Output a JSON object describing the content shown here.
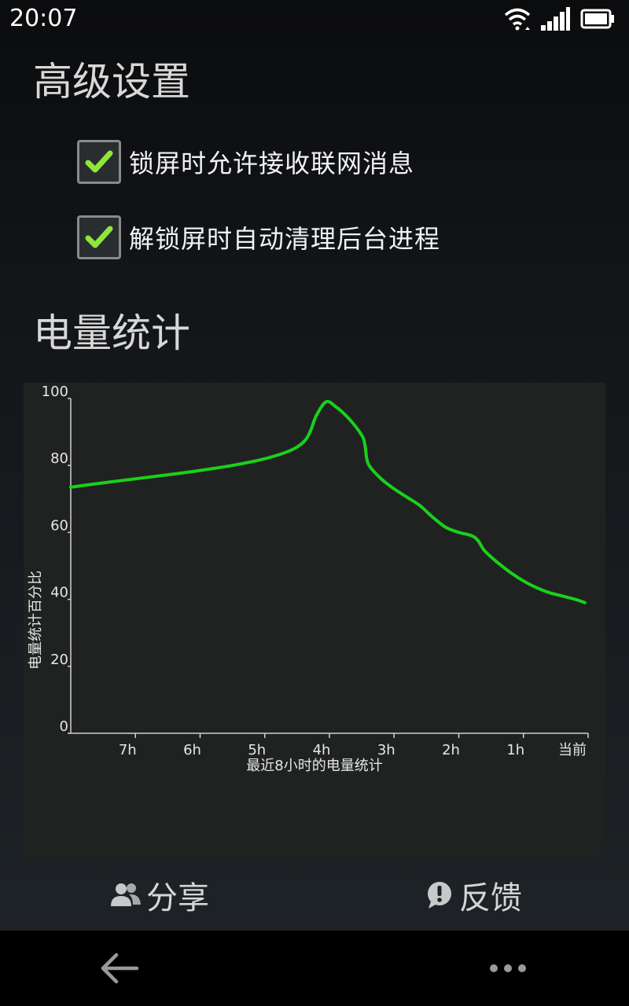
{
  "status_bar": {
    "time": "20:07"
  },
  "advanced_settings": {
    "title": "高级设置",
    "options": [
      {
        "label": "锁屏时允许接收联网消息",
        "checked": true
      },
      {
        "label": "解锁屏时自动清理后台进程",
        "checked": true
      }
    ]
  },
  "battery_stats": {
    "title": "电量统计"
  },
  "chart_data": {
    "type": "line",
    "title": "",
    "xlabel": "最近8小时的电量统计",
    "ylabel": "电量统计百分比",
    "ylim": [
      0,
      100
    ],
    "y_ticks": [
      "100",
      "80",
      "60",
      "40",
      "20",
      "0"
    ],
    "x_ticks": [
      "7h",
      "6h",
      "5h",
      "4h",
      "3h",
      "2h",
      "1h",
      "当前"
    ],
    "xlim": [
      -8,
      0
    ],
    "grid": false,
    "line_color": "#19d11a",
    "series": [
      {
        "x": [
          -8.0,
          -7.5,
          -7.0,
          -6.5,
          -6.0,
          -5.5,
          -5.0,
          -4.6,
          -4.4,
          -4.3,
          -4.2,
          -4.05,
          -3.9,
          -3.7,
          -3.5,
          -3.45,
          -3.4,
          -3.2,
          -3.0,
          -2.8,
          -2.6,
          -2.4,
          -2.2,
          -2.0,
          -1.8,
          -1.7,
          -1.6,
          -1.4,
          -1.2,
          -1.0,
          -0.8,
          -0.6,
          -0.4,
          -0.2,
          -0.05
        ],
        "y": [
          73.5,
          74.8,
          76,
          77.2,
          78.5,
          80,
          82,
          84.5,
          87,
          90,
          95,
          99,
          97.5,
          94,
          89,
          86,
          80.5,
          76,
          73,
          70.5,
          68,
          64.5,
          61.5,
          60,
          59,
          57.5,
          54.5,
          51,
          48,
          45.5,
          43.5,
          42,
          41,
          40,
          39
        ]
      }
    ]
  },
  "actions": {
    "share": {
      "label": "分享",
      "icon": "people-icon"
    },
    "feedback": {
      "label": "反馈",
      "icon": "exclamation-bubble-icon"
    }
  },
  "navigation": {
    "back_icon": "back-arrow-icon",
    "menu_icon": "more-dots-icon"
  }
}
